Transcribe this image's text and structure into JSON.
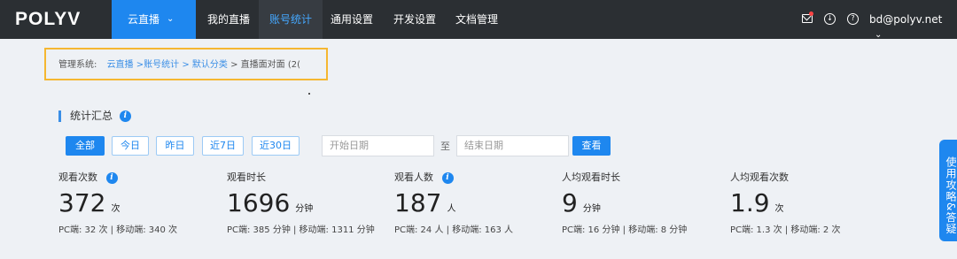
{
  "brand": "POLYV",
  "nav": {
    "active_menu": "云直播",
    "items": [
      "我的直播",
      "账号统计",
      "通用设置",
      "开发设置",
      "文档管理"
    ],
    "user": "bd@polyv.net"
  },
  "breadcrumb": {
    "prefix": "管理系统:",
    "l1": "云直播",
    "l2": ">账号统计",
    "l3": "> 默认分类",
    "l4": "> 直播面对面 (2("
  },
  "summary": {
    "title": "统计汇总",
    "filters": [
      "全部",
      "今日",
      "昨日",
      "近7日",
      "近30日"
    ],
    "active_filter": "全部",
    "start_placeholder": "开始日期",
    "to": "至",
    "end_placeholder": "结束日期",
    "search_label": "查看"
  },
  "stats": [
    {
      "label": "观看次数",
      "value": "372",
      "unit": "次",
      "sub": "PC端: 32 次 | 移动端: 340 次",
      "info": true
    },
    {
      "label": "观看时长",
      "value": "1696",
      "unit": "分钟",
      "sub": "PC端: 385 分钟 | 移动端: 1311 分钟",
      "info": false
    },
    {
      "label": "观看人数",
      "value": "187",
      "unit": "人",
      "sub": "PC端: 24 人 | 移动端: 163 人",
      "info": true
    },
    {
      "label": "人均观看时长",
      "value": "9",
      "unit": "分钟",
      "sub": "PC端: 16 分钟 | 移动端: 8 分钟",
      "info": false
    },
    {
      "label": "人均观看次数",
      "value": "1.9",
      "unit": "次",
      "sub": "PC端: 1.3 次 | 移动端: 2 次",
      "info": false
    }
  ],
  "side_tab": "使用攻略&答疑",
  "colors": {
    "accent": "#1e87ef",
    "topbar": "#2b2f33",
    "highlight_border": "#f5b731"
  }
}
